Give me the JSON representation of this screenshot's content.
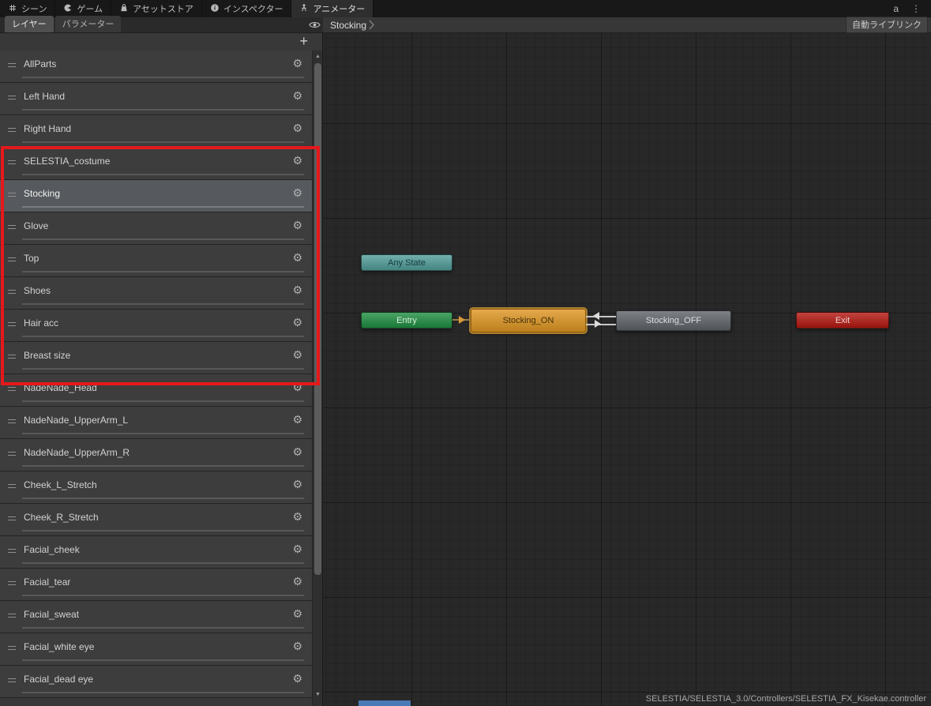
{
  "window": {
    "tabs": [
      {
        "label": "シーン"
      },
      {
        "label": "ゲーム"
      },
      {
        "label": "アセットストア"
      },
      {
        "label": "インスペクター"
      },
      {
        "label": "アニメーター",
        "active": true
      }
    ],
    "account_label": "a",
    "menu_label": "⋮"
  },
  "toolbar": {
    "layers_tab": "レイヤー",
    "parameters_tab": "パラメーター",
    "breadcrumb": "Stocking",
    "auto_live_link": "自動ライブリンク"
  },
  "layers_panel": {
    "add_button": "+",
    "scroll_up": "▲",
    "scroll_down": "▼",
    "gear_glyph": "⚙",
    "annotation_color": "#e5181b",
    "selected_layer": "Stocking",
    "layers": [
      {
        "name": "AllParts"
      },
      {
        "name": "Left Hand"
      },
      {
        "name": "Right Hand"
      },
      {
        "name": "SELESTIA_costume"
      },
      {
        "name": "Stocking",
        "selected": true
      },
      {
        "name": "Glove"
      },
      {
        "name": "Top"
      },
      {
        "name": "Shoes"
      },
      {
        "name": "Hair acc"
      },
      {
        "name": "Breast size"
      },
      {
        "name": "NadeNade_Head"
      },
      {
        "name": "NadeNade_UpperArm_L"
      },
      {
        "name": "NadeNade_UpperArm_R"
      },
      {
        "name": "Cheek_L_Stretch"
      },
      {
        "name": "Cheek_R_Stretch"
      },
      {
        "name": "Facial_cheek"
      },
      {
        "name": "Facial_tear"
      },
      {
        "name": "Facial_sweat"
      },
      {
        "name": "Facial_white eye"
      },
      {
        "name": "Facial_dead eye"
      }
    ]
  },
  "graph": {
    "nodes": [
      {
        "label": "Any State",
        "type": "any-state",
        "color": "#4e9b97"
      },
      {
        "label": "Entry",
        "type": "entry",
        "color": "#1d8c3f"
      },
      {
        "label": "Stocking_ON",
        "type": "state-selected",
        "color": "#dd9420"
      },
      {
        "label": "Stocking_OFF",
        "type": "state",
        "color": "#5d6167"
      },
      {
        "label": "Exit",
        "type": "exit",
        "color": "#b2150f"
      }
    ],
    "status_path": "SELESTIA/SELESTIA_3.0/Controllers/SELESTIA_FX_Kisekae.controller"
  }
}
